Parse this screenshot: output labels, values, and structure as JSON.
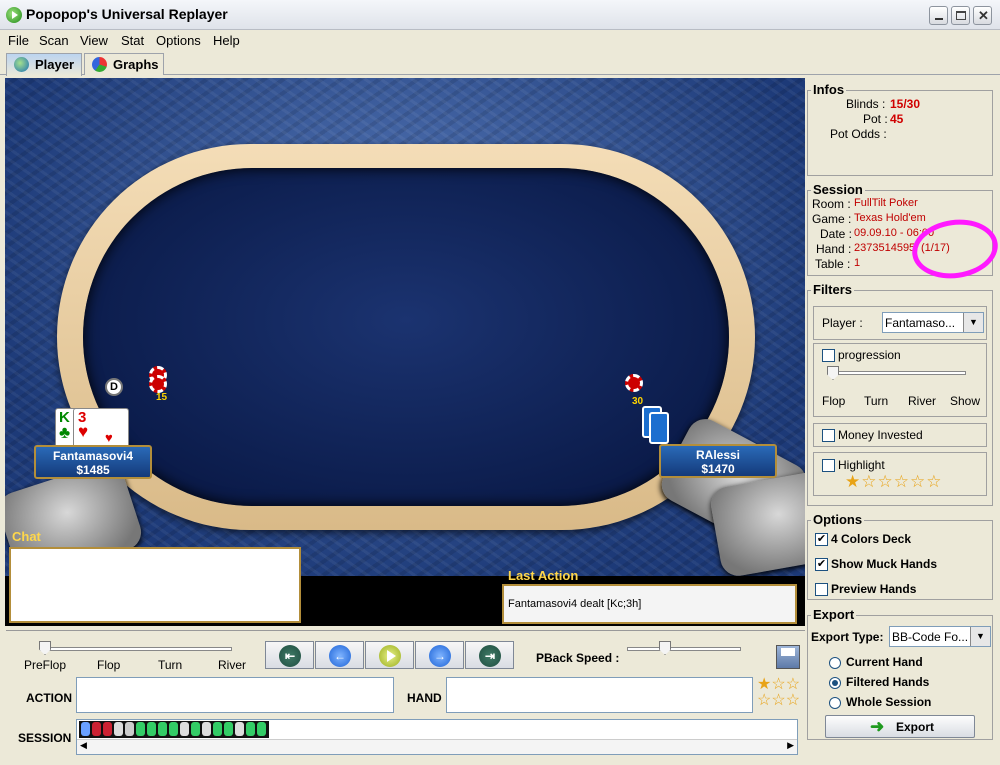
{
  "window": {
    "title": "Popopop's Universal Replayer"
  },
  "menu": [
    "File",
    "Scan",
    "View",
    "Stat",
    "Options",
    "Help"
  ],
  "tabs": [
    {
      "label": "Player"
    },
    {
      "label": "Graphs"
    }
  ],
  "table": {
    "players": [
      {
        "name": "Fantamasovi4",
        "stack": "$1485",
        "bet": "15",
        "cards": [
          "K",
          "3"
        ]
      },
      {
        "name": "RAlessi",
        "stack": "$1470",
        "bet": "30"
      }
    ],
    "dealer_button": "D"
  },
  "chat": {
    "title": "Chat"
  },
  "last_action": {
    "title": "Last Action",
    "text": "Fantamasovi4 dealt [Kc;3h]"
  },
  "streets": [
    "PreFlop",
    "Flop",
    "Turn",
    "River"
  ],
  "pback_label": "PBack Speed :",
  "action_label": "ACTION",
  "hand_label": "HAND",
  "session_label": "SESSION",
  "infos": {
    "title": "Infos",
    "blinds_label": "Blinds :",
    "blinds": "15/30",
    "pot_label": "Pot :",
    "pot": "45",
    "potodds_label": "Pot Odds :"
  },
  "session": {
    "title": "Session",
    "room_label": "Room :",
    "room": "FullTilt Poker",
    "game_label": "Game :",
    "game": "Texas Hold'em",
    "date_label": "Date :",
    "date": "09.09.10 - 06:00",
    "hand_label": "Hand :",
    "hand": "2373514595",
    "hand_idx": "(1/17)",
    "table_label": "Table :",
    "table": "1"
  },
  "filters": {
    "title": "Filters",
    "player_label": "Player :",
    "player_value": "Fantamaso...",
    "progression": "progression",
    "streets": [
      "Flop",
      "Turn",
      "River",
      "Show"
    ],
    "money": "Money Invested",
    "highlight": "Highlight"
  },
  "options": {
    "title": "Options",
    "items": [
      "4 Colors Deck",
      "Show Muck Hands",
      "Preview Hands"
    ]
  },
  "export": {
    "title": "Export",
    "type_label": "Export Type:",
    "type_value": "BB-Code Fo...",
    "radios": [
      "Current Hand",
      "Filtered Hands",
      "Whole Session"
    ],
    "button": "Export"
  }
}
